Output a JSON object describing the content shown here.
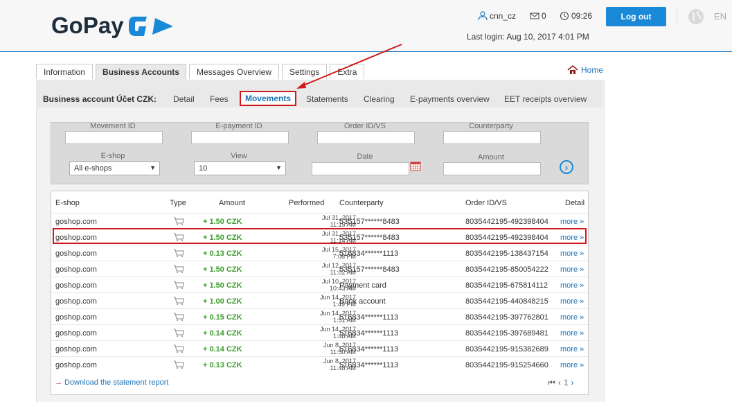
{
  "header": {
    "logo_text": "GoPay",
    "username": "cnn_cz",
    "messages_count": "0",
    "time": "09:26",
    "last_login": "Last login: Aug 10, 2017 4:01 PM",
    "logout_label": "Log out",
    "language": "EN",
    "brand_color": "#1a8ad8"
  },
  "tabs": [
    "Information",
    "Business Accounts",
    "Messages Overview",
    "Settings",
    "Extra"
  ],
  "active_tab": "Business Accounts",
  "home_label": "Home",
  "subnav": {
    "title": "Business account Účet CZK:",
    "links": [
      "Detail",
      "Fees",
      "Movements",
      "Statements",
      "Clearing",
      "E-payments overview",
      "EET receipts overview"
    ],
    "active": "Movements"
  },
  "filters": {
    "movement_id_label": "Movement ID",
    "epayment_id_label": "E-payment ID",
    "order_id_label": "Order ID/VS",
    "counterparty_label": "Counterparty",
    "eshop_label": "E-shop",
    "eshop_value": "All e-shops",
    "view_label": "View",
    "view_value": "10",
    "date_label": "Date",
    "amount_label": "Amount"
  },
  "table": {
    "headers": [
      "E-shop",
      "Type",
      "Amount",
      "Performed",
      "Counterparty",
      "Order ID/VS",
      "Detail"
    ],
    "rows": [
      {
        "eshop": "goshop.com",
        "amount": "+ 1.50 CZK",
        "date": "Jul 31, 2017",
        "time": "11:15 AM",
        "counterparty": "535157******8483",
        "order": "8035442195-492398404",
        "detail": "more »"
      },
      {
        "eshop": "goshop.com",
        "amount": "+ 1.50 CZK",
        "date": "Jul 31, 2017",
        "time": "11:14 AM",
        "counterparty": "535157******8483",
        "order": "8035442195-492398404",
        "detail": "more »"
      },
      {
        "eshop": "goshop.com",
        "amount": "+ 0.13 CZK",
        "date": "Jul 15, 2017",
        "time": "7:08 PM",
        "counterparty": "516834******1113",
        "order": "8035442195-138437154",
        "detail": "more »"
      },
      {
        "eshop": "goshop.com",
        "amount": "+ 1.50 CZK",
        "date": "Jul 12, 2017",
        "time": "11:02 AM",
        "counterparty": "535157******8483",
        "order": "8035442195-850054222",
        "detail": "more »"
      },
      {
        "eshop": "goshop.com",
        "amount": "+ 1.50 CZK",
        "date": "Jul 10, 2017",
        "time": "10:43 AM",
        "counterparty": "Payment card",
        "order": "8035442195-675814112",
        "detail": "more »"
      },
      {
        "eshop": "goshop.com",
        "amount": "+ 1.00 CZK",
        "date": "Jun 14, 2017",
        "time": "1:49 PM",
        "counterparty": "Bank account",
        "order": "8035442195-440848215",
        "detail": "more »"
      },
      {
        "eshop": "goshop.com",
        "amount": "+ 0.15 CZK",
        "date": "Jun 14, 2017",
        "time": "1:51 AM",
        "counterparty": "516834******1113",
        "order": "8035442195-397762801",
        "detail": "more »"
      },
      {
        "eshop": "goshop.com",
        "amount": "+ 0.14 CZK",
        "date": "Jun 14, 2017",
        "time": "1:48 AM",
        "counterparty": "516834******1113",
        "order": "8035442195-397689481",
        "detail": "more »"
      },
      {
        "eshop": "goshop.com",
        "amount": "+ 0.14 CZK",
        "date": "Jun 8, 2017",
        "time": "11:50 AM",
        "counterparty": "516834******1113",
        "order": "8035442195-915382689",
        "detail": "more »"
      },
      {
        "eshop": "goshop.com",
        "amount": "+ 0.13 CZK",
        "date": "Jun 8, 2017",
        "time": "11:48 AM",
        "counterparty": "516834******1113",
        "order": "8035442195-915254660",
        "detail": "more »"
      }
    ]
  },
  "footer": {
    "download_label": "Download the statement report",
    "page_number": "1"
  }
}
